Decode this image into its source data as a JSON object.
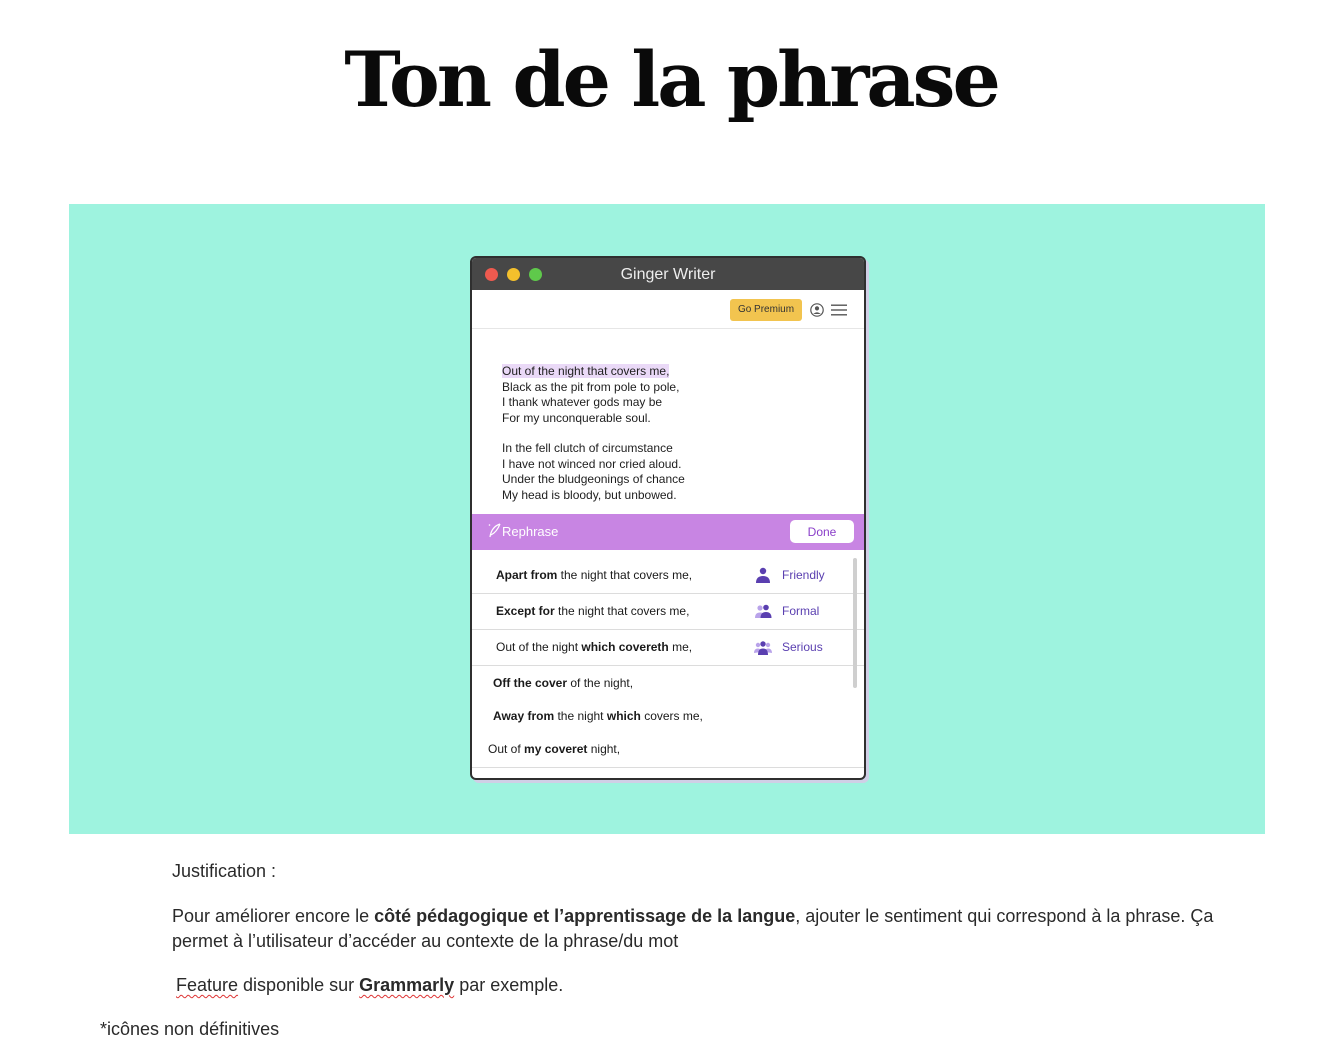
{
  "page": {
    "title": "Ton de la phrase"
  },
  "app": {
    "window_title": "Ginger Writer",
    "premium_label": "Go Premium",
    "poem_lines": [
      "Out of the night that covers me,",
      "Black as the pit from pole to pole,",
      "I thank whatever gods may be",
      "For my unconquerable soul.",
      "",
      "In the fell clutch of circumstance",
      "I have not winced nor cried aloud.",
      "Under the bludgeonings of chance",
      "My head is bloody, but unbowed."
    ],
    "rephrase": {
      "label": "Rephrase",
      "done_label": "Done"
    },
    "options": [
      {
        "parts": [
          {
            "t": "Apart from",
            "b": true
          },
          {
            "t": " the night that covers me,",
            "b": false
          }
        ],
        "tone": "Friendly",
        "icon": "person-icon"
      },
      {
        "parts": [
          {
            "t": "Except for",
            "b": true
          },
          {
            "t": " the night that covers me,",
            "b": false
          }
        ],
        "tone": "Formal",
        "icon": "two-people-icon"
      },
      {
        "parts": [
          {
            "t": "Out of the night ",
            "b": false
          },
          {
            "t": "which covereth",
            "b": true
          },
          {
            "t": " me,",
            "b": false
          }
        ],
        "tone": "Serious",
        "icon": "group-icon"
      },
      {
        "parts": [
          {
            "t": "Off the cover",
            "b": true
          },
          {
            "t": " of the night,",
            "b": false
          }
        ],
        "tone": "",
        "icon": ""
      },
      {
        "parts": [
          {
            "t": "Away from",
            "b": true
          },
          {
            "t": " the night ",
            "b": false
          },
          {
            "t": "which",
            "b": true
          },
          {
            "t": " covers me,",
            "b": false
          }
        ],
        "tone": "",
        "icon": ""
      },
      {
        "parts": [
          {
            "t": "Out of ",
            "b": false
          },
          {
            "t": "my coveret",
            "b": true
          },
          {
            "t": " night,",
            "b": false
          }
        ],
        "tone": "",
        "icon": ""
      }
    ],
    "colors": {
      "accent": "#c885e3",
      "premium": "#f2c44f",
      "tone": "#5a3fb0"
    }
  },
  "notes": {
    "justification_label": "Justification :",
    "para1": {
      "before": "Pour améliorer encore le ",
      "bold": "côté pédagogique et l’apprentissage de la langue",
      "after": ", ajouter le sentiment qui correspond à la phrase. Ça permet à l’utilisateur d’accéder au contexte de la phrase/du mot"
    },
    "para2": {
      "word1": "Feature",
      "middle": " disponible sur ",
      "bold": "Grammarly",
      "after": " par exemple."
    },
    "footnote": "*icônes non définitives"
  }
}
